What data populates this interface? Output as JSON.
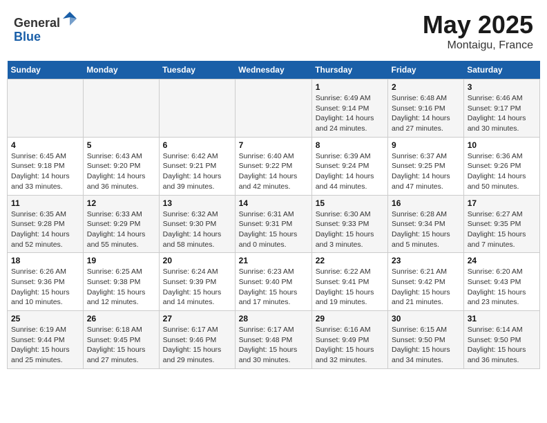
{
  "header": {
    "logo_line1": "General",
    "logo_line2": "Blue",
    "title": "May 2025",
    "location": "Montaigu, France"
  },
  "days_of_week": [
    "Sunday",
    "Monday",
    "Tuesday",
    "Wednesday",
    "Thursday",
    "Friday",
    "Saturday"
  ],
  "weeks": [
    [
      {
        "day": "",
        "info": ""
      },
      {
        "day": "",
        "info": ""
      },
      {
        "day": "",
        "info": ""
      },
      {
        "day": "",
        "info": ""
      },
      {
        "day": "1",
        "info": "Sunrise: 6:49 AM\nSunset: 9:14 PM\nDaylight: 14 hours\nand 24 minutes."
      },
      {
        "day": "2",
        "info": "Sunrise: 6:48 AM\nSunset: 9:16 PM\nDaylight: 14 hours\nand 27 minutes."
      },
      {
        "day": "3",
        "info": "Sunrise: 6:46 AM\nSunset: 9:17 PM\nDaylight: 14 hours\nand 30 minutes."
      }
    ],
    [
      {
        "day": "4",
        "info": "Sunrise: 6:45 AM\nSunset: 9:18 PM\nDaylight: 14 hours\nand 33 minutes."
      },
      {
        "day": "5",
        "info": "Sunrise: 6:43 AM\nSunset: 9:20 PM\nDaylight: 14 hours\nand 36 minutes."
      },
      {
        "day": "6",
        "info": "Sunrise: 6:42 AM\nSunset: 9:21 PM\nDaylight: 14 hours\nand 39 minutes."
      },
      {
        "day": "7",
        "info": "Sunrise: 6:40 AM\nSunset: 9:22 PM\nDaylight: 14 hours\nand 42 minutes."
      },
      {
        "day": "8",
        "info": "Sunrise: 6:39 AM\nSunset: 9:24 PM\nDaylight: 14 hours\nand 44 minutes."
      },
      {
        "day": "9",
        "info": "Sunrise: 6:37 AM\nSunset: 9:25 PM\nDaylight: 14 hours\nand 47 minutes."
      },
      {
        "day": "10",
        "info": "Sunrise: 6:36 AM\nSunset: 9:26 PM\nDaylight: 14 hours\nand 50 minutes."
      }
    ],
    [
      {
        "day": "11",
        "info": "Sunrise: 6:35 AM\nSunset: 9:28 PM\nDaylight: 14 hours\nand 52 minutes."
      },
      {
        "day": "12",
        "info": "Sunrise: 6:33 AM\nSunset: 9:29 PM\nDaylight: 14 hours\nand 55 minutes."
      },
      {
        "day": "13",
        "info": "Sunrise: 6:32 AM\nSunset: 9:30 PM\nDaylight: 14 hours\nand 58 minutes."
      },
      {
        "day": "14",
        "info": "Sunrise: 6:31 AM\nSunset: 9:31 PM\nDaylight: 15 hours\nand 0 minutes."
      },
      {
        "day": "15",
        "info": "Sunrise: 6:30 AM\nSunset: 9:33 PM\nDaylight: 15 hours\nand 3 minutes."
      },
      {
        "day": "16",
        "info": "Sunrise: 6:28 AM\nSunset: 9:34 PM\nDaylight: 15 hours\nand 5 minutes."
      },
      {
        "day": "17",
        "info": "Sunrise: 6:27 AM\nSunset: 9:35 PM\nDaylight: 15 hours\nand 7 minutes."
      }
    ],
    [
      {
        "day": "18",
        "info": "Sunrise: 6:26 AM\nSunset: 9:36 PM\nDaylight: 15 hours\nand 10 minutes."
      },
      {
        "day": "19",
        "info": "Sunrise: 6:25 AM\nSunset: 9:38 PM\nDaylight: 15 hours\nand 12 minutes."
      },
      {
        "day": "20",
        "info": "Sunrise: 6:24 AM\nSunset: 9:39 PM\nDaylight: 15 hours\nand 14 minutes."
      },
      {
        "day": "21",
        "info": "Sunrise: 6:23 AM\nSunset: 9:40 PM\nDaylight: 15 hours\nand 17 minutes."
      },
      {
        "day": "22",
        "info": "Sunrise: 6:22 AM\nSunset: 9:41 PM\nDaylight: 15 hours\nand 19 minutes."
      },
      {
        "day": "23",
        "info": "Sunrise: 6:21 AM\nSunset: 9:42 PM\nDaylight: 15 hours\nand 21 minutes."
      },
      {
        "day": "24",
        "info": "Sunrise: 6:20 AM\nSunset: 9:43 PM\nDaylight: 15 hours\nand 23 minutes."
      }
    ],
    [
      {
        "day": "25",
        "info": "Sunrise: 6:19 AM\nSunset: 9:44 PM\nDaylight: 15 hours\nand 25 minutes."
      },
      {
        "day": "26",
        "info": "Sunrise: 6:18 AM\nSunset: 9:45 PM\nDaylight: 15 hours\nand 27 minutes."
      },
      {
        "day": "27",
        "info": "Sunrise: 6:17 AM\nSunset: 9:46 PM\nDaylight: 15 hours\nand 29 minutes."
      },
      {
        "day": "28",
        "info": "Sunrise: 6:17 AM\nSunset: 9:48 PM\nDaylight: 15 hours\nand 30 minutes."
      },
      {
        "day": "29",
        "info": "Sunrise: 6:16 AM\nSunset: 9:49 PM\nDaylight: 15 hours\nand 32 minutes."
      },
      {
        "day": "30",
        "info": "Sunrise: 6:15 AM\nSunset: 9:50 PM\nDaylight: 15 hours\nand 34 minutes."
      },
      {
        "day": "31",
        "info": "Sunrise: 6:14 AM\nSunset: 9:50 PM\nDaylight: 15 hours\nand 36 minutes."
      }
    ]
  ]
}
